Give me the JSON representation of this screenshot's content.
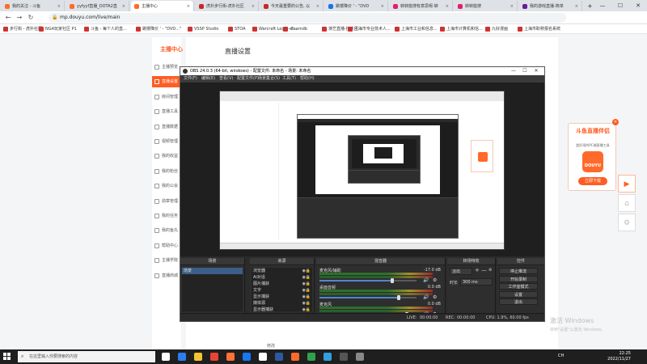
{
  "browser": {
    "tabs": [
      {
        "label": "我的关注 - 斗鱼",
        "color": "#ff6a2b"
      },
      {
        "label": "yyfyyf直播_DOTA2直",
        "color": "#ff6a2b"
      },
      {
        "label": "主播中心",
        "color": "#ff6a2b",
        "active": true
      },
      {
        "label": "虎扑步行街-虎扑社区",
        "color": "#c62828"
      },
      {
        "label": "今天最重要的公告, 以",
        "color": "#c62828"
      },
      {
        "label": "跳楼降价 ' - \"DVD",
        "color": "#1a73e8"
      },
      {
        "label": "转转能搜有意思呢-转",
        "color": "#e0206c"
      },
      {
        "label": "转转能搜",
        "color": "#e0206c"
      },
      {
        "label": "我的游戏直播-简单",
        "color": "#6a1b9a"
      }
    ],
    "new_tab": "+",
    "window_controls": [
      "—",
      "☐",
      "✕"
    ],
    "nav": {
      "back": "←",
      "forward": "→",
      "reload": "↻"
    },
    "url": "mp.douyu.com/live/main",
    "bookmarks": [
      "步行街 - 虎扑社区",
      "NGA玩家社区 P1",
      "斗鱼 - 每个人的直...",
      "跳楼降价 ' - \"DVD...\"",
      "VSSP Studio",
      "STOA",
      "Warcraft Logo - C...",
      "steamdb",
      "演艺直播-技术团...",
      "上海市专业技术人...",
      "上海市工业和信息...",
      "上海市计算机和信...",
      "九好漫画",
      "上海市职称报名系统"
    ]
  },
  "sidebar": {
    "title": "主播中心",
    "items": [
      {
        "label": "主播预览",
        "active": false
      },
      {
        "label": "直播设置",
        "active": true
      },
      {
        "label": "房间管理",
        "active": false
      },
      {
        "label": "直播工具",
        "active": false
      },
      {
        "label": "直播数据",
        "active": false
      },
      {
        "label": "视频管理",
        "active": false
      },
      {
        "label": "我的收益",
        "active": false
      },
      {
        "label": "我的粉丝",
        "active": false
      },
      {
        "label": "我的公会",
        "active": false
      },
      {
        "label": "勋章管理",
        "active": false
      },
      {
        "label": "我的任务",
        "active": false
      },
      {
        "label": "我的鱼丸",
        "active": false
      },
      {
        "label": "帮助中心",
        "active": false
      },
      {
        "label": "主播学院",
        "active": false
      },
      {
        "label": "直播商城",
        "active": false
      }
    ]
  },
  "main": {
    "title": "直播设置",
    "footer_label": "修改"
  },
  "obs": {
    "title": "OBS 24.0.3 (64-bit, windows) - 配置文件: 未命名 - 场景: 未命名",
    "controls": [
      "—",
      "☐",
      "✕"
    ],
    "menu": [
      "文件(F)",
      "编辑(E)",
      "查看(V)",
      "配置文件(P)",
      "场景集合(S)",
      "工具(T)",
      "帮助(H)"
    ],
    "docks": {
      "scenes": {
        "title": "场景",
        "items": [
          "场景"
        ]
      },
      "sources": {
        "title": "来源",
        "items": [
          "浏览器",
          "Ai对话",
          "图片捕获",
          "文字",
          "显示捕获",
          "媒体源",
          "显示器捕获"
        ]
      },
      "mixer": {
        "title": "混音器",
        "channels": [
          {
            "name": "麦克风/辅助",
            "db": "-17.0 dB",
            "level": 0.75
          },
          {
            "name": "桌面音频",
            "db": "0.0 dB",
            "level": 0.82
          },
          {
            "name": "麦克风",
            "db": "0.0 dB",
            "level": 0.9
          }
        ]
      },
      "transitions": {
        "title": "转场特效",
        "type": "淡出",
        "duration_label": "时长",
        "duration": "300 ms"
      },
      "controls": {
        "title": "控件",
        "buttons": [
          "停止推流",
          "开始录制",
          "工作室模式",
          "设置",
          "退出"
        ]
      }
    },
    "status": {
      "live_label": "LIVE:",
      "live_time": "00:00:00",
      "rec_label": "REC:",
      "rec_time": "00:00:00",
      "cpu": "CPU: 1.9%, 60.00 fps"
    },
    "dock_tools": [
      "+",
      "—",
      "∧",
      "∨"
    ],
    "source_tools": [
      "+",
      "—",
      "⚙",
      "∧",
      "∨"
    ]
  },
  "ad": {
    "close": "✕",
    "title": "斗鱼直播伴侣",
    "subtitle": "超好用的PC端直播工具",
    "logo": "DOUYU",
    "download": "立即下载"
  },
  "float_buttons": [
    "▶",
    "⌂",
    "⚙"
  ],
  "watermark": {
    "title": "激活 Windows",
    "subtitle": "转到\"设置\"以激活 Windows。"
  },
  "taskbar": {
    "search_placeholder": "在这里输入你要搜索的内容",
    "icon_colors": [
      "#ffffff",
      "#2e7df0",
      "#f4c430",
      "#ea4335",
      "#ff7139",
      "#1877f2",
      "#ffffff",
      "#2c5aa0",
      "#ff6a2b",
      "#31a24c",
      "#30a0e0",
      "#555555",
      "#888888"
    ],
    "tray_text": "CH",
    "time": "22:25",
    "date": "2022/11/27"
  }
}
